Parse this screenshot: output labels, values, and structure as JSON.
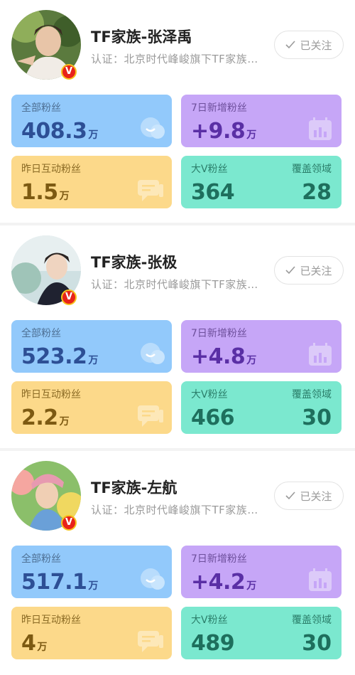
{
  "colors": {
    "fans_bg": "#92c9fb",
    "new_bg": "#c6a6f7",
    "interact_bg": "#fcd98a",
    "bigv_bg": "#7be8cf",
    "verified_badge": "#e8231a"
  },
  "icons": {
    "verified": "verified-v-badge-icon",
    "follow_check": "checkmark-icon",
    "fans_deco": "chat-bubble-icon",
    "new_deco": "calendar-chart-icon",
    "interact_deco": "message-icon"
  },
  "cards": [
    {
      "name": "TF家族-张泽禹",
      "cert": "认证：北京时代峰峻旗下TF家族…",
      "verified_mark": "V",
      "follow_label": "已关注",
      "fans_label": "全部粉丝",
      "fans_value": "408.3",
      "fans_unit": "万",
      "new_label": "7日新增粉丝",
      "new_value": "+9.8",
      "new_unit": "万",
      "interact_label": "昨日互动粉丝",
      "interact_value": "1.5",
      "interact_unit": "万",
      "bigv_label": "大V粉丝",
      "bigv_value": "364",
      "coverage_label": "覆盖领域",
      "coverage_value": "28"
    },
    {
      "name": "TF家族-张极",
      "cert": "认证：北京时代峰峻旗下TF家族…",
      "verified_mark": "V",
      "follow_label": "已关注",
      "fans_label": "全部粉丝",
      "fans_value": "523.2",
      "fans_unit": "万",
      "new_label": "7日新增粉丝",
      "new_value": "+4.8",
      "new_unit": "万",
      "interact_label": "昨日互动粉丝",
      "interact_value": "2.2",
      "interact_unit": "万",
      "bigv_label": "大V粉丝",
      "bigv_value": "466",
      "coverage_label": "覆盖领域",
      "coverage_value": "30"
    },
    {
      "name": "TF家族-左航",
      "cert": "认证：北京时代峰峻旗下TF家族…",
      "verified_mark": "V",
      "follow_label": "已关注",
      "fans_label": "全部粉丝",
      "fans_value": "517.1",
      "fans_unit": "万",
      "new_label": "7日新增粉丝",
      "new_value": "+4.2",
      "new_unit": "万",
      "interact_label": "昨日互动粉丝",
      "interact_value": "4",
      "interact_unit": "万",
      "bigv_label": "大V粉丝",
      "bigv_value": "489",
      "coverage_label": "覆盖领域",
      "coverage_value": "30"
    }
  ]
}
